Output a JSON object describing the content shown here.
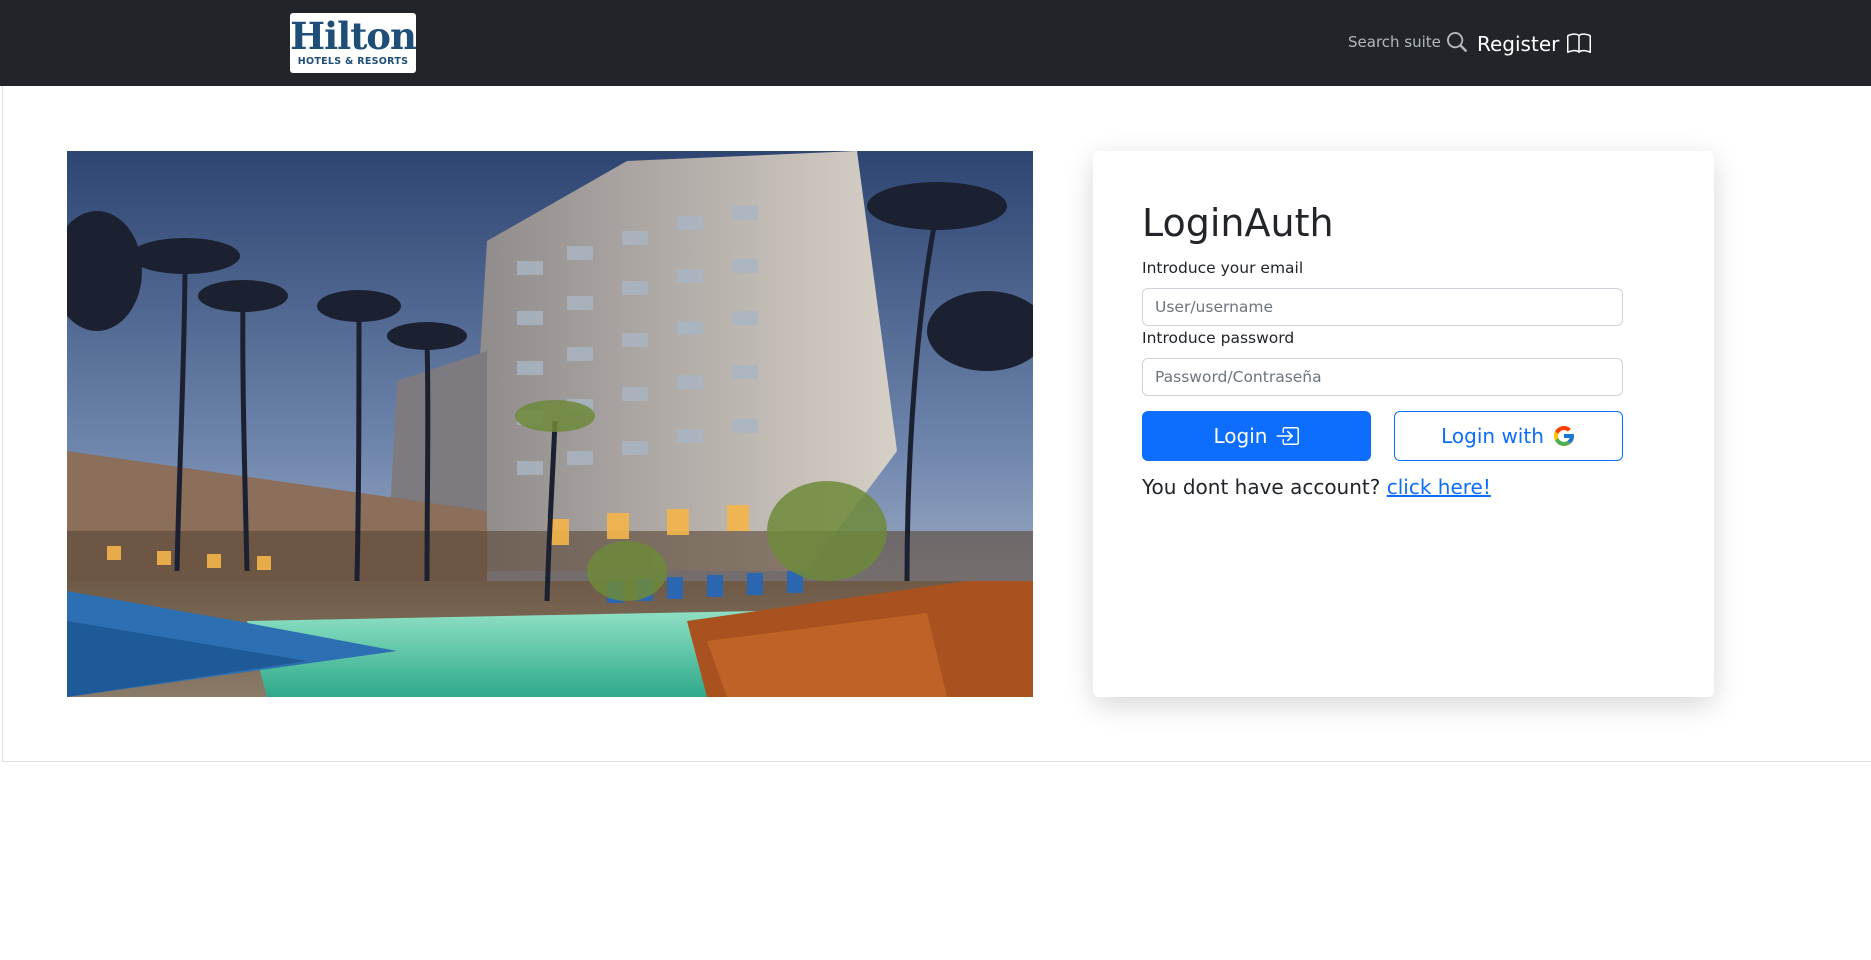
{
  "navbar": {
    "logo": {
      "word": "Hilton",
      "tagline": "HOTELS & RESORTS"
    },
    "search_label": "Search suite",
    "register_label": "Register"
  },
  "hero": {
    "alt": "Hotel pool at dusk"
  },
  "login": {
    "title": "LoginAuth",
    "email_label": "Introduce your email",
    "email_placeholder": "User/username",
    "email_value": "",
    "password_label": "Introduce password",
    "password_placeholder": "Password/Contraseña",
    "password_value": "",
    "login_button": "Login",
    "google_button": "Login with",
    "account_prompt": "You dont have account?",
    "account_link": "click here!"
  },
  "icons": {
    "search": "search-icon",
    "register": "book-icon",
    "login": "box-arrow-in-right-icon",
    "google": "google-icon"
  },
  "colors": {
    "navbar_bg": "#212529",
    "primary": "#0d6efd",
    "brand": "#1f4e79"
  }
}
